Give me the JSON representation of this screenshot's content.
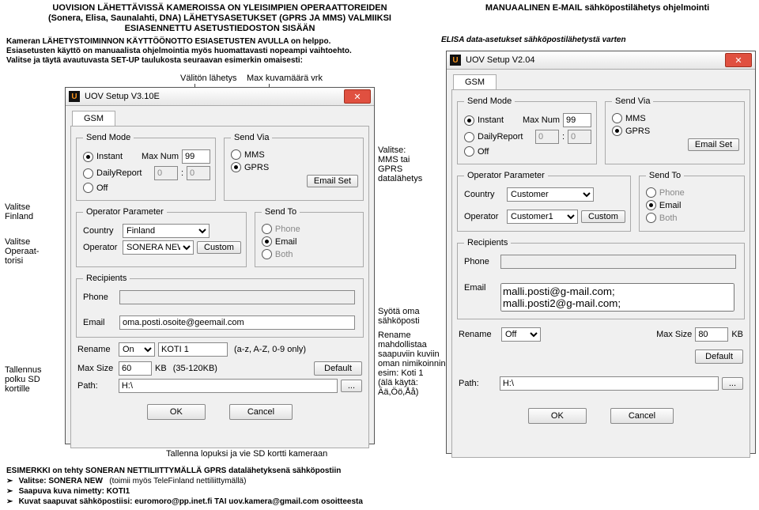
{
  "left_header": {
    "l1": "UOVISION LÄHETTÄVISSÄ KAMEROISSA ON YLEISIMPIEN OPERAATTOREIDEN",
    "l2": "(Sonera, Elisa, Saunalahti, DNA) LÄHETYSASETUKSET (GPRS JA MMS) VALMIIKSI",
    "l3": "ESIASENNETTU ASETUSTIEDOSTON SISÄÄN"
  },
  "left_notes": {
    "n1": "Kameran LÄHETYSTOIMINNON KÄYTTÖÖNOTTO ESIASETUSTEN AVULLA on helppo.",
    "n2": "Esiasetusten käyttö on manuaalista ohjelmointia myös huomattavasti nopeampi vaihtoehto.",
    "n3": "Valitse ja täytä avautuvasta SET-UP taulukosta seuraavan esimerkin omaisesti:"
  },
  "captions": {
    "top1": "Välitön lähetys",
    "top2": "Max kuvamäärä vrk",
    "sendvia": "Valitse:\nMMS tai GPRS\ndatalähetys",
    "finland": "Valitse\nFinland",
    "operator": "Valitse\nOperaat-\ntorisi",
    "email": "Syötä oma\nsähköposti",
    "rename": "Rename\nmahdollistaa\nsaapuviin kuviin\noman nimikoinnin\nesim: Koti 1\n(älä käytä:\nÄä,Öö,Åå)",
    "path": "Tallennus\npolku SD\nkortille",
    "bottomcap": "Tallenna lopuksi ja vie SD kortti kameraan"
  },
  "dlg1": {
    "title": "UOV Setup V3.10E",
    "tab": "GSM",
    "send_mode": "Send Mode",
    "instant": "Instant",
    "daily": "DailyReport",
    "off": "Off",
    "maxnum_lbl": "Max Num",
    "maxnum_val": "99",
    "dr_h": "0",
    "dr_m": "0",
    "send_via": "Send Via",
    "mms": "MMS",
    "gprs": "GPRS",
    "emailset": "Email Set",
    "op_param": "Operator Parameter",
    "country": "Country",
    "country_val": "Finland",
    "operator": "Operator",
    "operator_val": "SONERA NEW",
    "custom": "Custom",
    "send_to": "Send To",
    "phone": "Phone",
    "email": "Email",
    "both": "Both",
    "recipients": "Recipients",
    "rec_phone": "Phone",
    "rec_email": "Email",
    "email_val": "oma.posti.osoite@geemail.com",
    "rename": "Rename",
    "rename_sel": "On",
    "rename_val": "KOTI 1",
    "rename_hint": "(a-z, A-Z, 0-9 only)",
    "maxsize": "Max Size",
    "maxsize_val": "60",
    "kb": "KB",
    "kb_hint": "(35-120KB)",
    "default": "Default",
    "path": "Path:",
    "path_val": "H:\\",
    "browse": "...",
    "ok": "OK",
    "cancel": "Cancel"
  },
  "right_header": {
    "t": "MANUAALINEN E-MAIL sähköpostilähetys ohjelmointi",
    "s": "ELISA data-asetukset sähköpostilähetystä varten"
  },
  "dlg2": {
    "title": "UOV Setup V2.04",
    "tab": "GSM",
    "send_mode": "Send Mode",
    "instant": "Instant",
    "daily": "DailyReport",
    "off": "Off",
    "maxnum_lbl": "Max Num",
    "maxnum_val": "99",
    "dr_h": "0",
    "dr_m": "0",
    "send_via": "Send Via",
    "mms": "MMS",
    "gprs": "GPRS",
    "emailset": "Email Set",
    "op_param": "Operator Parameter",
    "country": "Country",
    "country_val": "Customer",
    "operator": "Operator",
    "operator_val": "Customer1",
    "custom": "Custom",
    "send_to": "Send To",
    "phone": "Phone",
    "email": "Email",
    "both": "Both",
    "recipients": "Recipients",
    "rec_phone": "Phone",
    "rec_email": "Email",
    "email_val": "malli.posti@g-mail.com;\nmalli.posti2@g-mail.com;",
    "rename": "Rename",
    "rename_sel": "Off",
    "maxsize": "Max Size",
    "maxsize_val": "80",
    "kb": "KB",
    "default": "Default",
    "path": "Path:",
    "path_val": "H:\\",
    "browse": "...",
    "ok": "OK",
    "cancel": "Cancel"
  },
  "footer": {
    "l1": "ESIMERKKI on tehty SONERAN NETTILIITTYMÄLLÄ GPRS datalähetyksenä sähköpostiin",
    "l2a": "Valitse: SONERA NEW",
    "l2b": "(toimii myös TeleFinland nettiliittymällä)",
    "l3": "Saapuva kuva nimetty: KOTI1",
    "l4": "Kuvat saapuvat sähköpostiisi: euromoro@pp.inet.fi TAI uov.kamera@gmail.com osoitteesta",
    "bullet": "➢"
  }
}
